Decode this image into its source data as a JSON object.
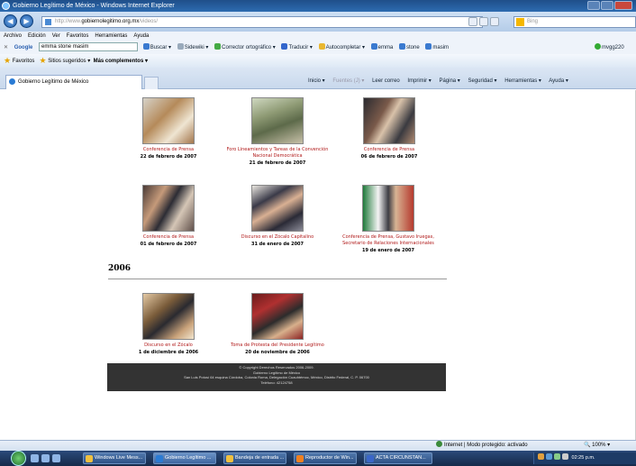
{
  "window": {
    "title": "Gobierno Legítimo de México - Windows Internet Explorer"
  },
  "address": {
    "url_prefix": "http://www.",
    "url_domain": "gobiernolegitimo.org.mx",
    "url_suffix": "/videos/",
    "search_placeholder": "Bing"
  },
  "menu": [
    "Archivo",
    "Edición",
    "Ver",
    "Favoritos",
    "Herramientas",
    "Ayuda"
  ],
  "googlebar": {
    "brand": "Google",
    "query": "emma stone masim",
    "items": [
      "Buscar ▾",
      "Sidewiki ▾",
      "Corrector ortográfico ▾",
      "Traducir ▾",
      "Autocompletar ▾",
      "emma",
      "stone",
      "masim",
      "mvgg220"
    ]
  },
  "favbar": {
    "favoritos": "Favoritos",
    "sugeridos": "Sitios sugeridos ▾",
    "complementos": "Más complementos ▾"
  },
  "tab": {
    "title": "Gobierno Legítimo de México"
  },
  "commandbar": [
    "Inicio ▾",
    "Fuentes (J) ▾",
    "Leer correo",
    "Imprimir ▾",
    "Página ▾",
    "Seguridad ▾",
    "Herramientas ▾",
    "Ayuda ▾"
  ],
  "videos": [
    {
      "caption": "Conferencia de Prensa",
      "date": "22 de febrero de 2007"
    },
    {
      "caption": "Foro Lineamientos y Tareas de la Convención Nacional Democrática",
      "date": "21 de febrero de 2007"
    },
    {
      "caption": "Conferencia de Prensa",
      "date": "06 de febrero de 2007"
    },
    {
      "caption": "Conferencia de Prensa",
      "date": "01 de febrero de 2007"
    },
    {
      "caption": "Discurso en el Zócalo Capitalino",
      "date": "31 de enero de 2007"
    },
    {
      "caption": "Conferencia de Prensa, Gustavo Iruegas, Secretario de Relaciones Internacionales",
      "date": "19 de enero de 2007"
    }
  ],
  "year_heading": "2006",
  "videos_2006": [
    {
      "caption": "Discurso en el Zócalo",
      "date": "1 de diciembre de 2006"
    },
    {
      "caption": "Toma de Protesta del Presidente Legítimo",
      "date": "20 de noviembre de 2006"
    }
  ],
  "footer": {
    "line1": "© Copyright Derechos Reservados 2006-2009.",
    "line2": "Gobierno Legítimo de México",
    "line3": "San Luis Potosí 64 esquina Córdoba, Colonia Roma, Delegación Cuauhtémoc, México, Distrito Federal, C. P. 06700",
    "line4": "Teléfono: 42124758"
  },
  "status": {
    "zone": "Internet | Modo protegido: activado",
    "zoom": "100%"
  },
  "taskbar": {
    "tasks": [
      "Windows Live Mess...",
      "Gobierno Legítimo ...",
      "Bandeja de entrada ...",
      "Reproductor de Win...",
      "ACTA CIRCUNSTAN..."
    ],
    "clock": "02:25 p.m."
  }
}
